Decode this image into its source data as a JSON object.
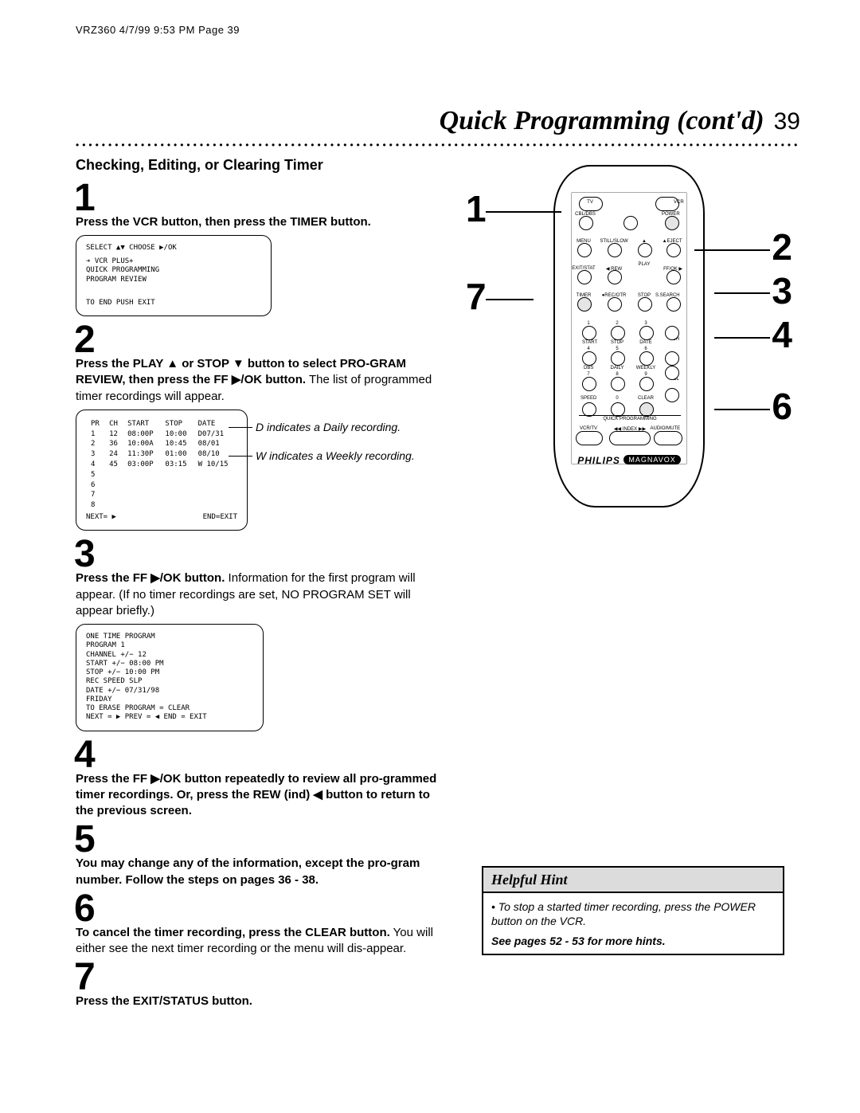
{
  "slugline": "VRZ360  4/7/99 9:53 PM  Page 39",
  "header": {
    "title": "Quick Programming (cont'd)",
    "pagenum": "39"
  },
  "section_title": "Checking, Editing, or Clearing Timer",
  "steps": {
    "1": {
      "num": "1",
      "text": "Press the VCR button, then press the TIMER button.",
      "osd": {
        "line1": "SELECT ▲▼     CHOOSE ▶/OK",
        "items": [
          "➔ VCR PLUS+",
          "  QUICK PROGRAMMING",
          "  PROGRAM REVIEW"
        ],
        "footer": "TO END PUSH EXIT"
      }
    },
    "2": {
      "num": "2",
      "bold_pre": "Press the PLAY ▲ or STOP ▼ button to select PRO-GRAM REVIEW, then press the FF ▶/OK button.",
      "rest": " The list of programmed timer recordings will appear.",
      "table_head": [
        "PR",
        "CH",
        "START",
        "STOP",
        "DATE"
      ],
      "table_rows": [
        [
          "1",
          "12",
          "08:00P",
          "10:00",
          "D07/31"
        ],
        [
          "2",
          "36",
          "10:00A",
          "10:45",
          "08/01"
        ],
        [
          "3",
          "24",
          "11:30P",
          "01:00",
          "08/10"
        ],
        [
          "4",
          "45",
          "03:00P",
          "03:15",
          "W 10/15"
        ],
        [
          "5",
          "",
          "",
          "",
          ""
        ],
        [
          "6",
          "",
          "",
          "",
          ""
        ],
        [
          "7",
          "",
          "",
          "",
          ""
        ],
        [
          "8",
          "",
          "",
          "",
          ""
        ]
      ],
      "table_footer_left": "NEXT= ▶",
      "table_footer_right": "END=EXIT",
      "annot_d": "D indicates a Daily recording.",
      "annot_w": "W indicates a Weekly recording."
    },
    "3": {
      "num": "3",
      "bold": "Press the FF ▶/OK button.",
      "rest": " Information for the first program will appear. (If no timer recordings are set, NO PROGRAM SET will appear briefly.)",
      "osd_lines": [
        "ONE TIME PROGRAM",
        " PROGRAM       1",
        " CHANNEL +/−  12",
        " START +/−     08:00  PM",
        " STOP +/−       10:00  PM",
        " REC SPEED    SLP",
        " DATE +/−      07/31/98",
        "                      FRIDAY",
        "TO ERASE PROGRAM = CLEAR",
        "NEXT = ▶  PREV = ◀  END = EXIT"
      ]
    },
    "4": {
      "num": "4",
      "text": "Press the FF ▶/OK button repeatedly to review all pro-grammed timer recordings. Or, press the REW (ind) ◀ button to return to the previous screen."
    },
    "5": {
      "num": "5",
      "text": "You may change any of the information, except the pro-gram number.  Follow the steps on pages 36 - 38."
    },
    "6": {
      "num": "6",
      "bold": "To cancel the timer recording, press the CLEAR button.",
      "rest": " You will either see the next timer recording or the menu will dis-appear."
    },
    "7": {
      "num": "7",
      "text": "Press the EXIT/STATUS button."
    }
  },
  "hint": {
    "head": "Helpful Hint",
    "body": "To stop a started timer recording, press the POWER button on the VCR.",
    "foot": "See pages 52 - 53 for more hints."
  },
  "callouts": {
    "c1": "1",
    "c2": "2",
    "c3": "3",
    "c4": "4",
    "c6": "6",
    "c7": "7"
  },
  "remote": {
    "row1": {
      "tv": "TV",
      "vcr": "VCR"
    },
    "row2": {
      "cbldbs": "CBL/DBS",
      "blank": "",
      "power": "POWER"
    },
    "row3": {
      "menu": "MENU",
      "still": "STILL/SLOW",
      "up": "▲",
      "eject": "▲EJECT"
    },
    "row4": {
      "exit": "EXIT/STAT",
      "rew": "◀ REW",
      "play": "PLAY",
      "ff": "FF/OK ▶"
    },
    "row5": {
      "timer": "TIMER",
      "rec": "●REC/OTR",
      "stop": "STOP",
      "search": "S.SEARCH"
    },
    "digits_top": {
      "d1": "1",
      "d2": "2",
      "d3": "3",
      "d4": "4",
      "d5": "5",
      "d6": "6",
      "d7": "7",
      "d8": "8",
      "d9": "9",
      "d0": "0"
    },
    "labs": {
      "start": "START",
      "stop": "STOP",
      "date": "DATE",
      "ch": "CH",
      "dbs": "DBS",
      "daily": "DAILY",
      "weekly": "WEEKLY",
      "vol": "VOL",
      "speed": "SPEED",
      "clear": "CLEAR",
      "quick": "QUICK PROGRAMMING"
    },
    "bottom": {
      "vcrtv": "VCR/TV",
      "index": "◀◀ INDEX ▶▶",
      "audio": "AUDIO/MUTE"
    },
    "brand": "PHILIPS",
    "brand2": "MAGNAVOX"
  }
}
